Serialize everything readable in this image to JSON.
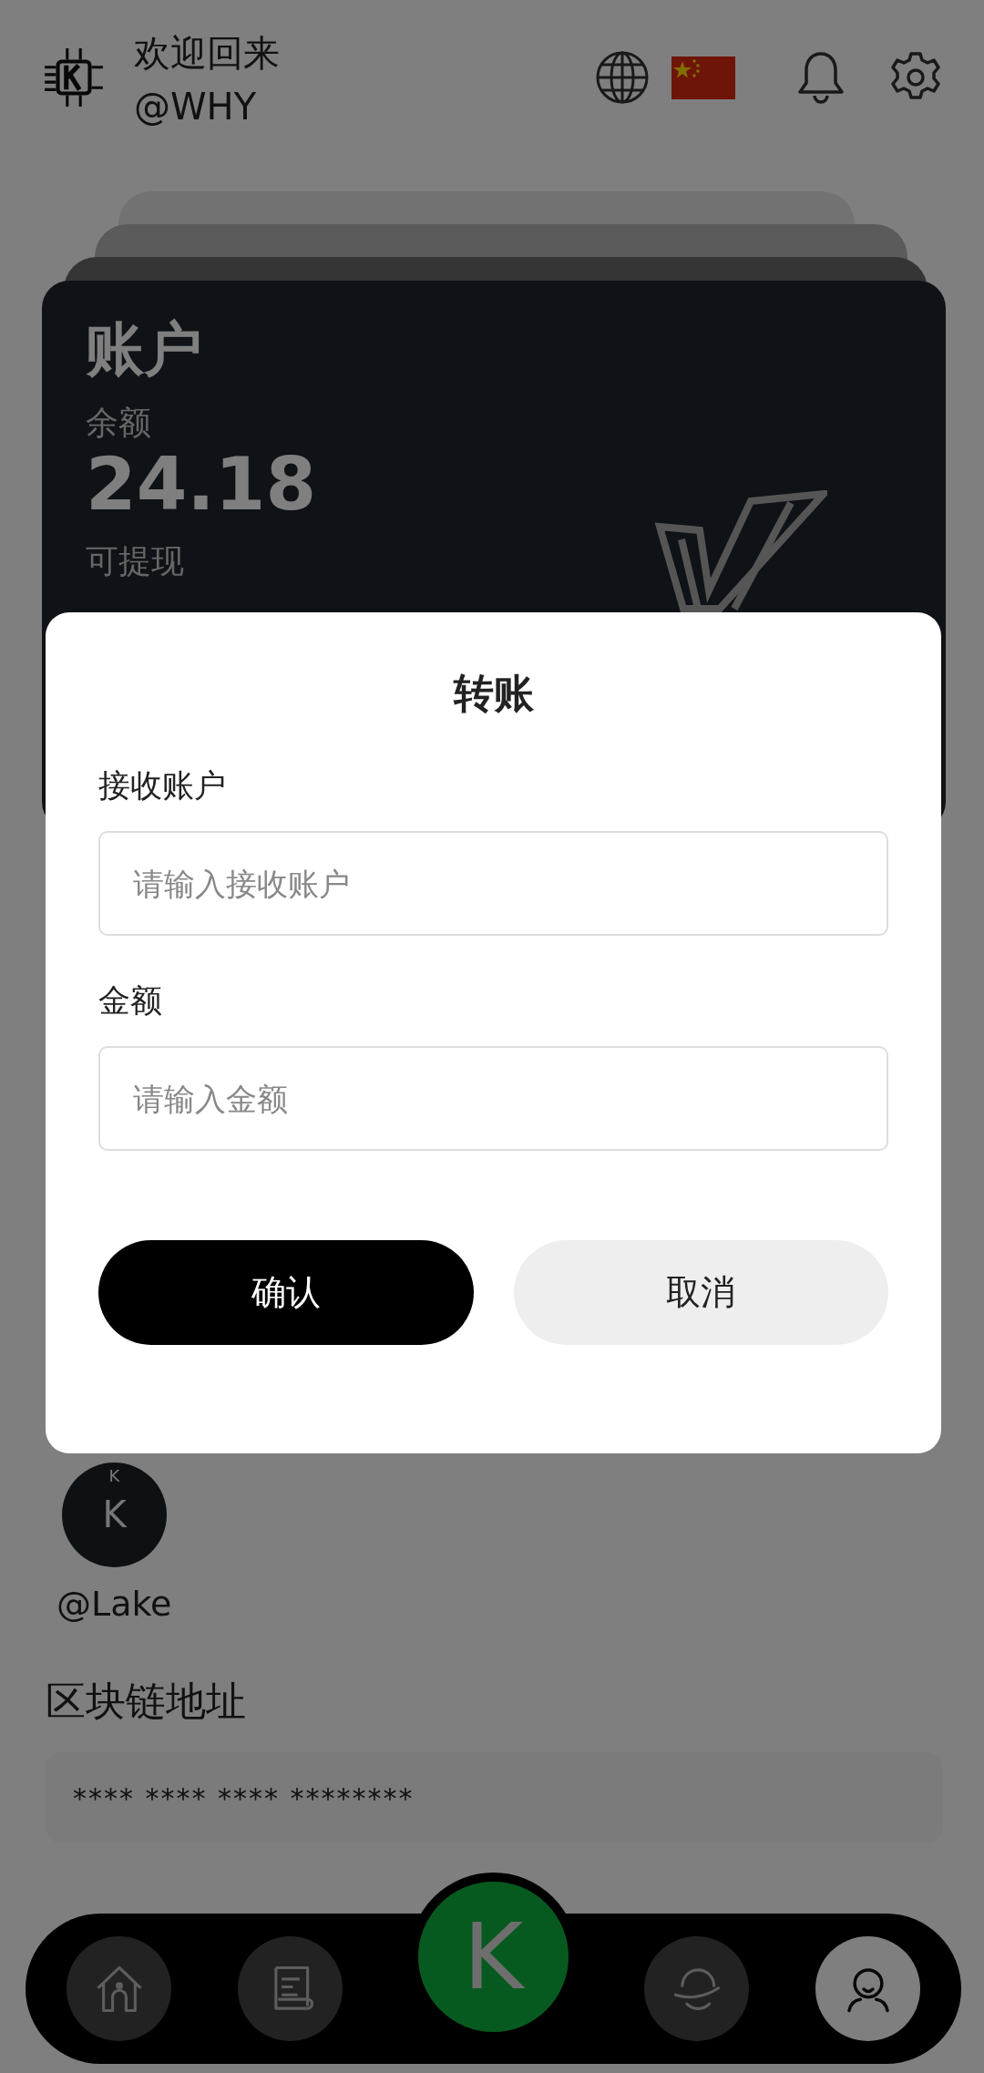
{
  "header": {
    "greeting": "欢迎回来",
    "username": "@WHY"
  },
  "account_card": {
    "title": "账户",
    "balance_label": "余额",
    "balance": "24.18",
    "withdrawable_label": "可提现"
  },
  "contact": {
    "name": "@Lake",
    "avatar_letter": "K",
    "avatar_small_letter": "K"
  },
  "blockchain": {
    "label": "区块链地址",
    "address": "**** **** **** ********"
  },
  "bottom_nav": {
    "center_label": "K",
    "items": [
      {
        "selected": false
      },
      {
        "selected": false
      },
      {
        "selected": false
      },
      {
        "selected": true
      }
    ]
  },
  "dialog": {
    "title": "转账",
    "fields": [
      {
        "label": "接收账户",
        "placeholder": "请输入接收账户"
      },
      {
        "label": "金额",
        "placeholder": "请输入金额"
      }
    ],
    "confirm": "确认",
    "cancel": "取消"
  }
}
